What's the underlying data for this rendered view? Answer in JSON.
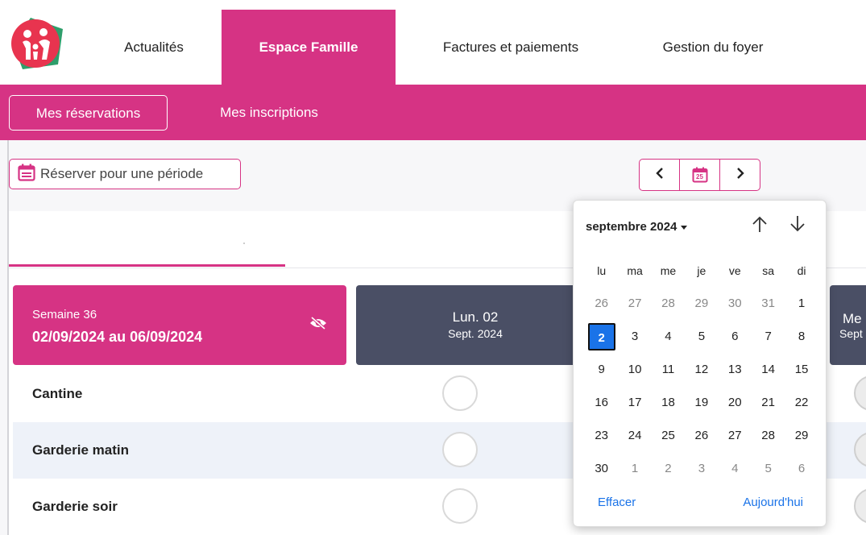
{
  "nav": {
    "items": [
      {
        "label": "Actualités"
      },
      {
        "label": "Espace Famille"
      },
      {
        "label": "Factures et paiements"
      },
      {
        "label": "Gestion du foyer"
      }
    ]
  },
  "subnav": {
    "items": [
      {
        "label": "Mes réservations"
      },
      {
        "label": "Mes inscriptions"
      }
    ]
  },
  "toolbar": {
    "period_label": "Réserver pour une période",
    "calendar_badge": "25"
  },
  "week": {
    "label": "Semaine 36",
    "dates": "02/09/2024 au 06/09/2024"
  },
  "days": [
    {
      "name": "Lun. 02",
      "date": "Sept. 2024"
    },
    {
      "name": "Me",
      "date": "Sept"
    }
  ],
  "rows": [
    {
      "label": "Cantine"
    },
    {
      "label": "Garderie matin"
    },
    {
      "label": "Garderie soir"
    }
  ],
  "datepicker": {
    "month_label": "septembre 2024",
    "weekdays": [
      "lu",
      "ma",
      "me",
      "je",
      "ve",
      "sa",
      "di"
    ],
    "weeks": [
      [
        "26",
        "27",
        "28",
        "29",
        "30",
        "31",
        "1"
      ],
      [
        "2",
        "3",
        "4",
        "5",
        "6",
        "7",
        "8"
      ],
      [
        "9",
        "10",
        "11",
        "12",
        "13",
        "14",
        "15"
      ],
      [
        "16",
        "17",
        "18",
        "19",
        "20",
        "21",
        "22"
      ],
      [
        "23",
        "24",
        "25",
        "26",
        "27",
        "28",
        "29"
      ],
      [
        "30",
        "1",
        "2",
        "3",
        "4",
        "5",
        "6"
      ]
    ],
    "selected": "2",
    "clear_label": "Effacer",
    "today_label": "Aujourd'hui"
  },
  "colors": {
    "brand": "#d63384",
    "day_header": "#4a4f65",
    "selection": "#1a73e8"
  }
}
